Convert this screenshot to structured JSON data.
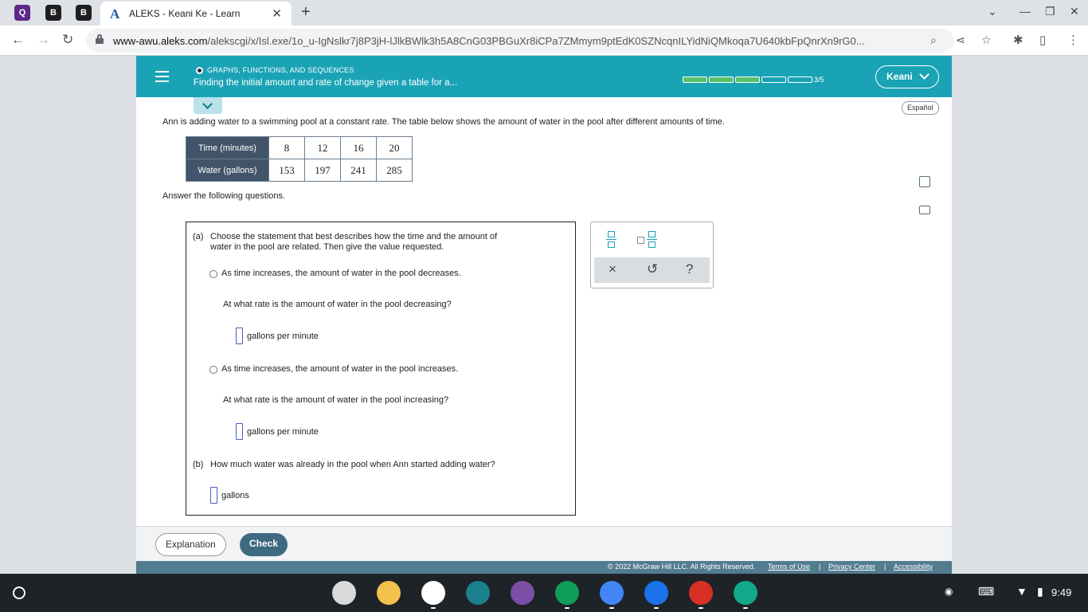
{
  "browser": {
    "pinned_tabs": [
      "Q",
      "B",
      "B"
    ],
    "tab_title": "ALEKS - Keani Ke - Learn",
    "tab_icon": "A",
    "url_domain": "www-awu.aleks.com",
    "url_path": "/alekscgi/x/Isl.exe/1o_u-IgNslkr7j8P3jH-lJlkBWlk3h5A8CnG03PBGuXr8iCPa7ZMmym9ptEdK0SZNcqnILYidNiQMkoqa7U640kbFpQnrXn9rG0..."
  },
  "header": {
    "topic_name": "GRAPHS, FUNCTIONS, AND SEQUENCES",
    "topic_title": "Finding the initial amount and rate of change given a table for a...",
    "progress": {
      "completed": 3,
      "total": 5,
      "label": "3/5"
    },
    "user_label": "Keani"
  },
  "content": {
    "language_button": "Español",
    "problem_text": "Ann is adding water to a swimming pool at a constant rate. The table below shows the amount of water in the pool after different amounts of time.",
    "table": {
      "rows": [
        {
          "header": "Time (minutes)",
          "values": [
            "8",
            "12",
            "16",
            "20"
          ]
        },
        {
          "header": "Water (gallons)",
          "values": [
            "153",
            "197",
            "241",
            "285"
          ]
        }
      ]
    },
    "answer_lead": "Answer the following questions.",
    "part_a": {
      "label": "(a)",
      "text_line1": "Choose the statement that best describes how the time and the amount of",
      "text_line2": "water in the pool are related. Then give the value requested.",
      "option1": "As time increases, the amount of water in the pool decreases.",
      "option1_question": "At what rate is the amount of water in the pool decreasing?",
      "option1_unit": "gallons per minute",
      "option2": "As time increases, the amount of water in the pool increases.",
      "option2_question": "At what rate is the amount of water in the pool increasing?",
      "option2_unit": "gallons per minute"
    },
    "part_b": {
      "label": "(b)",
      "text": "How much water was already in the pool when Ann started adding water?",
      "unit": "gallons"
    },
    "tools": {
      "clear": "×",
      "undo": "↺",
      "help": "?"
    }
  },
  "footer": {
    "explanation_button": "Explanation",
    "check_button": "Check",
    "copyright": "© 2022 McGraw Hill LLC. All Rights Reserved.",
    "terms": "Terms of Use",
    "privacy": "Privacy Center",
    "accessibility": "Accessibility",
    "separator": "|"
  },
  "shelf": {
    "time": "9:49",
    "app_colors": [
      "#d9d9d9",
      "#f2c14e",
      "#ffffff",
      "#1b7f8c",
      "#7b4fa6",
      "#0f9d58",
      "#4285f4",
      "#1a73e8",
      "#d93025",
      "#12a88a"
    ]
  }
}
